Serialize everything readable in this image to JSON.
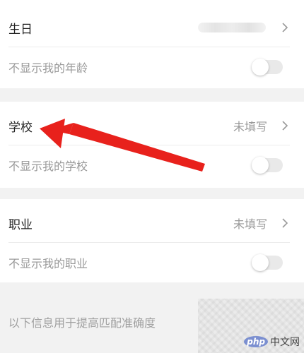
{
  "birthday": {
    "label": "生日",
    "hide_label": "不显示我的年龄",
    "hide_enabled": false
  },
  "school": {
    "label": "学校",
    "value": "未填写",
    "hide_label": "不显示我的学校",
    "hide_enabled": false
  },
  "job": {
    "label": "职业",
    "value": "未填写",
    "hide_label": "不显示我的职业",
    "hide_enabled": false
  },
  "info": {
    "text": "以下信息用于提高匹配准确度"
  },
  "watermark": {
    "logo": "php",
    "text": "中文网"
  },
  "colors": {
    "arrow": "#e8211c",
    "toggle_off": "#e9e9e9",
    "chevron": "#9a9a9a"
  }
}
